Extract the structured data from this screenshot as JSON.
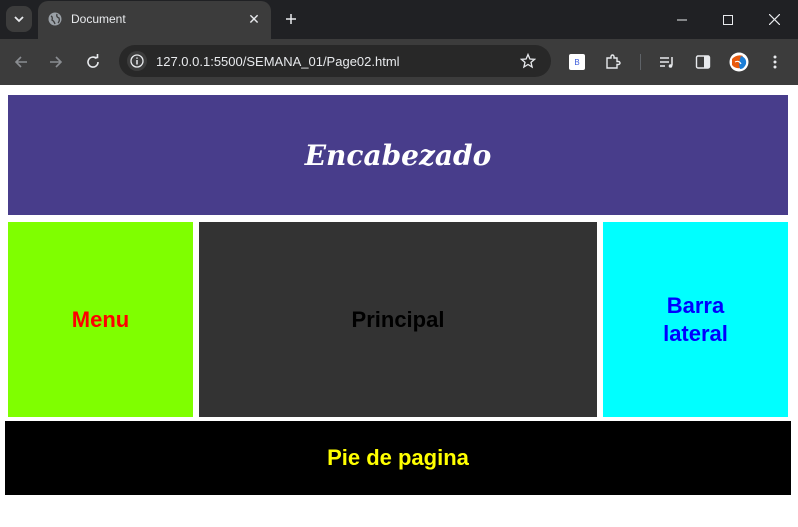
{
  "browser": {
    "tab_title": "Document",
    "url": "127.0.0.1:5500/SEMANA_01/Page02.html",
    "extension_badge": "B"
  },
  "page": {
    "header": "Encabezado",
    "menu": "Menu",
    "main": "Principal",
    "aside": "Barra lateral",
    "footer": "Pie de pagina"
  },
  "colors": {
    "header_bg": "#483d8b",
    "menu_bg": "#7fff00",
    "menu_text": "#ff0000",
    "main_bg": "#333333",
    "aside_bg": "#00ffff",
    "aside_text": "#0000ff",
    "footer_bg": "#000000",
    "footer_text": "#ffff00"
  },
  "icons": {
    "tab_menu": "chevron-down-icon",
    "favicon": "globe-icon",
    "tab_close": "close-icon",
    "new_tab": "plus-icon",
    "minimize": "minimize-icon",
    "maximize": "maximize-icon",
    "close_window": "close-window-icon",
    "back": "back-arrow-icon",
    "forward": "forward-arrow-icon",
    "reload": "reload-icon",
    "site_info": "info-icon",
    "bookmark": "star-icon",
    "extensions": "puzzle-icon",
    "media": "media-control-icon",
    "side_panel": "side-panel-icon",
    "profile": "profile-avatar-icon",
    "more": "more-vert-icon"
  }
}
